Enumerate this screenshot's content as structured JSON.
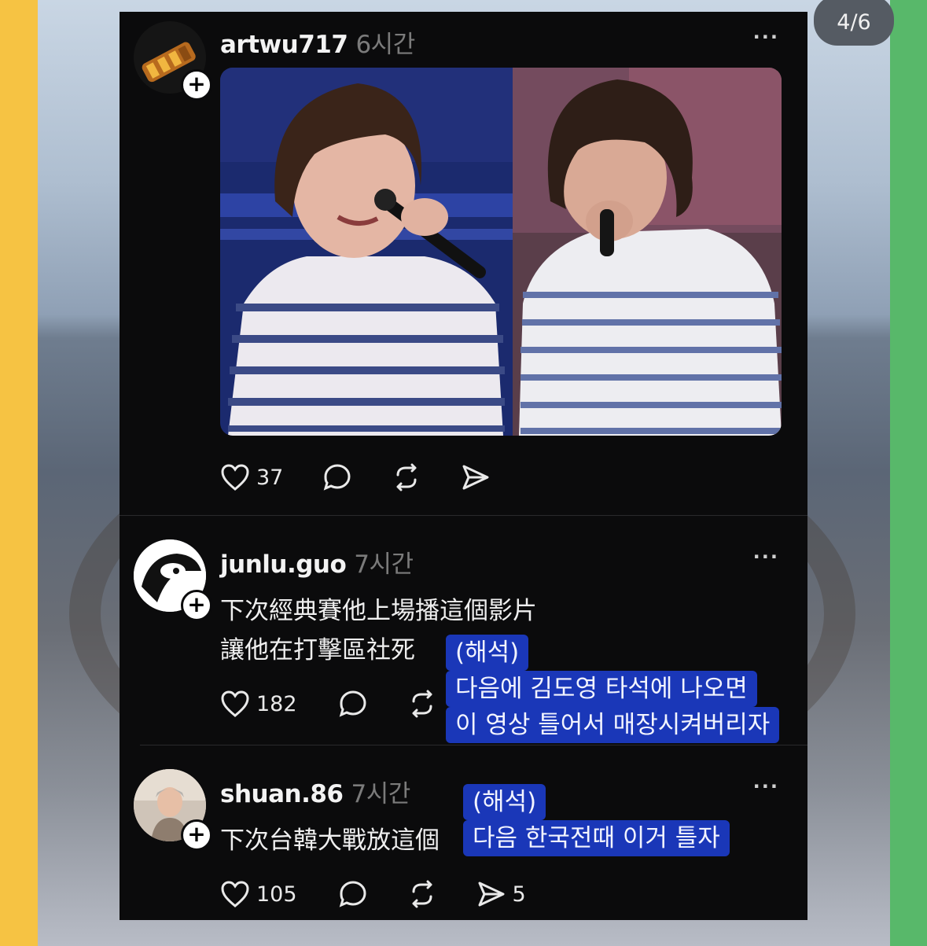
{
  "page_counter": "4/6",
  "posts": [
    {
      "username": "artwu717",
      "time": "6시간",
      "text": "",
      "likes": "37",
      "shares": ""
    },
    {
      "username": "junlu.guo",
      "time": "7시간",
      "text_line1": "下次經典賽他上場播這個影片",
      "text_line2": "讓他在打擊區社死",
      "likes": "182"
    },
    {
      "username": "shuan.86",
      "time": "7시간",
      "text_line1": "下次台韓大戰放這個",
      "likes": "105",
      "shares": "5"
    }
  ],
  "annotations": {
    "first": {
      "line1": "(해석)",
      "line2": "다음에 김도영 타석에 나오면",
      "line3": "이 영상 틀어서 매장시켜버리자"
    },
    "second": {
      "line1": "(해석)",
      "line2": "다음 한국전때 이거 틀자"
    }
  },
  "more_label": "···",
  "icons": [
    "heart-icon",
    "comment-icon",
    "repost-icon",
    "share-icon",
    "plus-icon"
  ],
  "colors": {
    "card_bg": "#0b0b0c",
    "annotation_bg": "#1a37b8",
    "left_strip": "#f6c343",
    "right_strip": "#58b86a"
  }
}
